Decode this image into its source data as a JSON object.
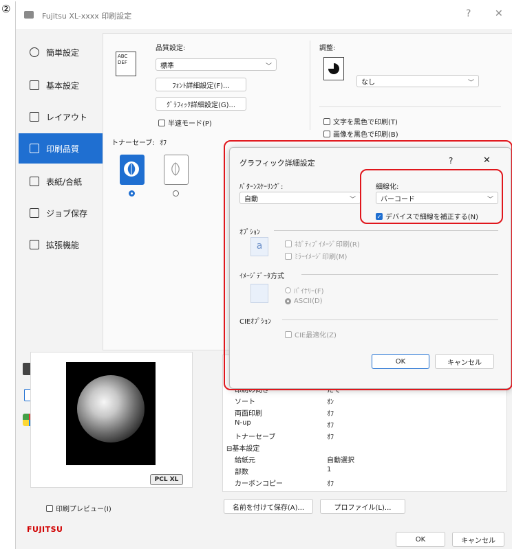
{
  "step_marker": "②",
  "window": {
    "title": "Fujitsu XL-xxxx 印刷設定",
    "help": "?",
    "close": "✕"
  },
  "sidebar": [
    {
      "label": "簡単設定",
      "icon": "clock-icon"
    },
    {
      "label": "基本設定",
      "icon": "page-icon"
    },
    {
      "label": "レイアウト",
      "icon": "grid-icon"
    },
    {
      "label": "印刷品質",
      "icon": "image-icon"
    },
    {
      "label": "表紙/合紙",
      "icon": "cover-icon"
    },
    {
      "label": "ジョブ保存",
      "icon": "job-icon"
    },
    {
      "label": "拡張機能",
      "icon": "extend-icon"
    }
  ],
  "quality": {
    "heading": "品質設定:",
    "icon_text": "ABC DEF",
    "select_value": "標準",
    "font_button": "ﾌｫﾝﾄ詳細設定(F)...",
    "graphic_button": "ｸﾞﾗﾌｨｯｸ詳細設定(G)...",
    "halftone": "半速モード(P)",
    "toner_label": "トナーセーブ:",
    "toner_value": "ｵﾌ"
  },
  "adjust": {
    "heading": "調整:",
    "select_value": "なし",
    "text_black": "文字を黒色で印刷(T)",
    "image_black": "画像を黒色で印刷(B)"
  },
  "dialog": {
    "title": "グラフィック詳細設定",
    "help": "?",
    "close": "✕",
    "pattern_label": "ﾊﾟﾀｰﾝｽｹｰﾘﾝｸﾞ:",
    "pattern_value": "自動",
    "thin_label": "細線化:",
    "thin_value": "バーコード",
    "thin_check": "デバイスで細線を補正する(N)",
    "options_label": "ｵﾌﾟｼｮﾝ",
    "negative": "ﾈｶﾞﾃｨﾌﾞｲﾒｰｼﾞ印刷(R)",
    "mirror": "ﾐﾗｰｲﾒｰｼﾞ印刷(M)",
    "image_format_label": "ｲﾒｰｼﾞﾃﾞｰﾀ方式",
    "binary": "ﾊﾞｲﾅﾘｰ(F)",
    "ascii": "ASCII(D)",
    "cie_label": "CIEｵﾌﾟｼｮﾝ",
    "cie_opt": "CIE最適化(Z)",
    "ok": "OK",
    "cancel": "キャンセル",
    "icon_letter": "a"
  },
  "summary": [
    {
      "key": "印刷の向き",
      "value": "たて"
    },
    {
      "key": "ソート",
      "value": "ｵﾝ"
    },
    {
      "key": "両面印刷",
      "value": "ｵﾌ"
    },
    {
      "key": "N-up",
      "value": "ｵﾌ"
    },
    {
      "key": "トナーセーブ",
      "value": "ｵﾌ"
    },
    {
      "key": "⊟基本設定",
      "value": ""
    },
    {
      "key": "給紙元",
      "value": "自動選択"
    },
    {
      "key": "部数",
      "value": "1"
    },
    {
      "key": "カーボンコピー",
      "value": "ｵﾌ"
    }
  ],
  "preview": {
    "badge": "PCL XL",
    "print_preview": "印刷プレビュー(I)"
  },
  "footer": {
    "save_as": "名前を付けて保存(A)...",
    "profile": "プロファイル(L)...",
    "brand": "FUJITSU",
    "ok": "OK",
    "cancel": "キャンセル"
  },
  "colors": {
    "accent": "#1f6fd1",
    "highlight": "#e0161c",
    "brand": "#d10000"
  }
}
